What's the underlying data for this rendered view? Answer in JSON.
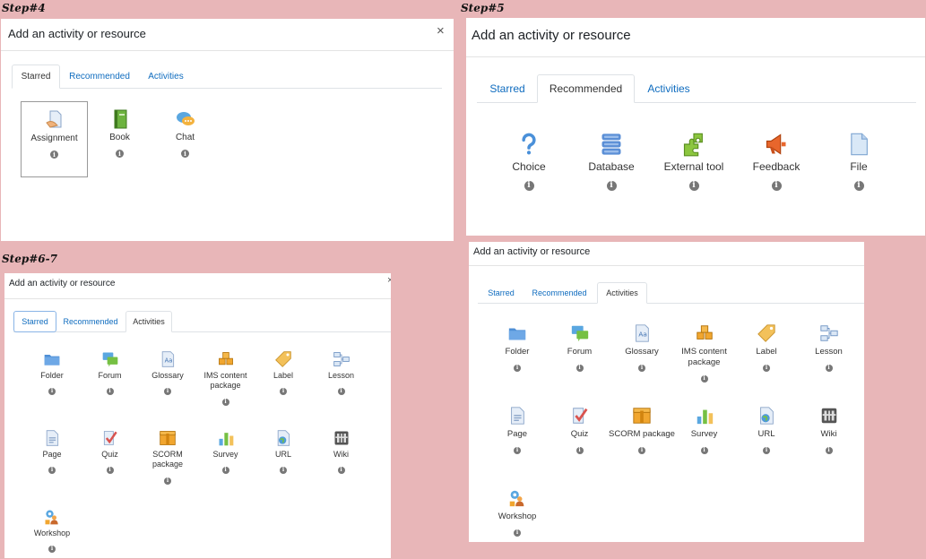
{
  "steps": {
    "s4": "Step#4",
    "s5": "Step#5",
    "s67": "Step#6-7"
  },
  "dialog_title": "Add an activity or resource",
  "close_symbol": "×",
  "tabs": {
    "starred": "Starred",
    "recommended": "Recommended",
    "activities": "Activities"
  },
  "info_symbol": "i",
  "starred_items": [
    {
      "label": "Assignment",
      "icon": "assignment-icon"
    },
    {
      "label": "Book",
      "icon": "book-icon"
    },
    {
      "label": "Chat",
      "icon": "chat-icon"
    }
  ],
  "recommended_items": [
    {
      "label": "Choice",
      "icon": "choice-icon"
    },
    {
      "label": "Database",
      "icon": "database-icon"
    },
    {
      "label": "External tool",
      "icon": "external-tool-icon"
    },
    {
      "label": "Feedback",
      "icon": "feedback-icon"
    },
    {
      "label": "File",
      "icon": "file-icon"
    }
  ],
  "activities": [
    {
      "label": "Folder",
      "icon": "folder-icon"
    },
    {
      "label": "Forum",
      "icon": "forum-icon"
    },
    {
      "label": "Glossary",
      "icon": "glossary-icon"
    },
    {
      "label": "IMS content package",
      "icon": "ims-package-icon"
    },
    {
      "label": "Label",
      "icon": "label-icon"
    },
    {
      "label": "Lesson",
      "icon": "lesson-icon"
    },
    {
      "label": "Page",
      "icon": "page-icon"
    },
    {
      "label": "Quiz",
      "icon": "quiz-icon"
    },
    {
      "label": "SCORM package",
      "icon": "scorm-icon"
    },
    {
      "label": "Survey",
      "icon": "survey-icon"
    },
    {
      "label": "URL",
      "icon": "url-icon"
    },
    {
      "label": "Wiki",
      "icon": "wiki-icon"
    },
    {
      "label": "Workshop",
      "icon": "workshop-icon"
    }
  ]
}
